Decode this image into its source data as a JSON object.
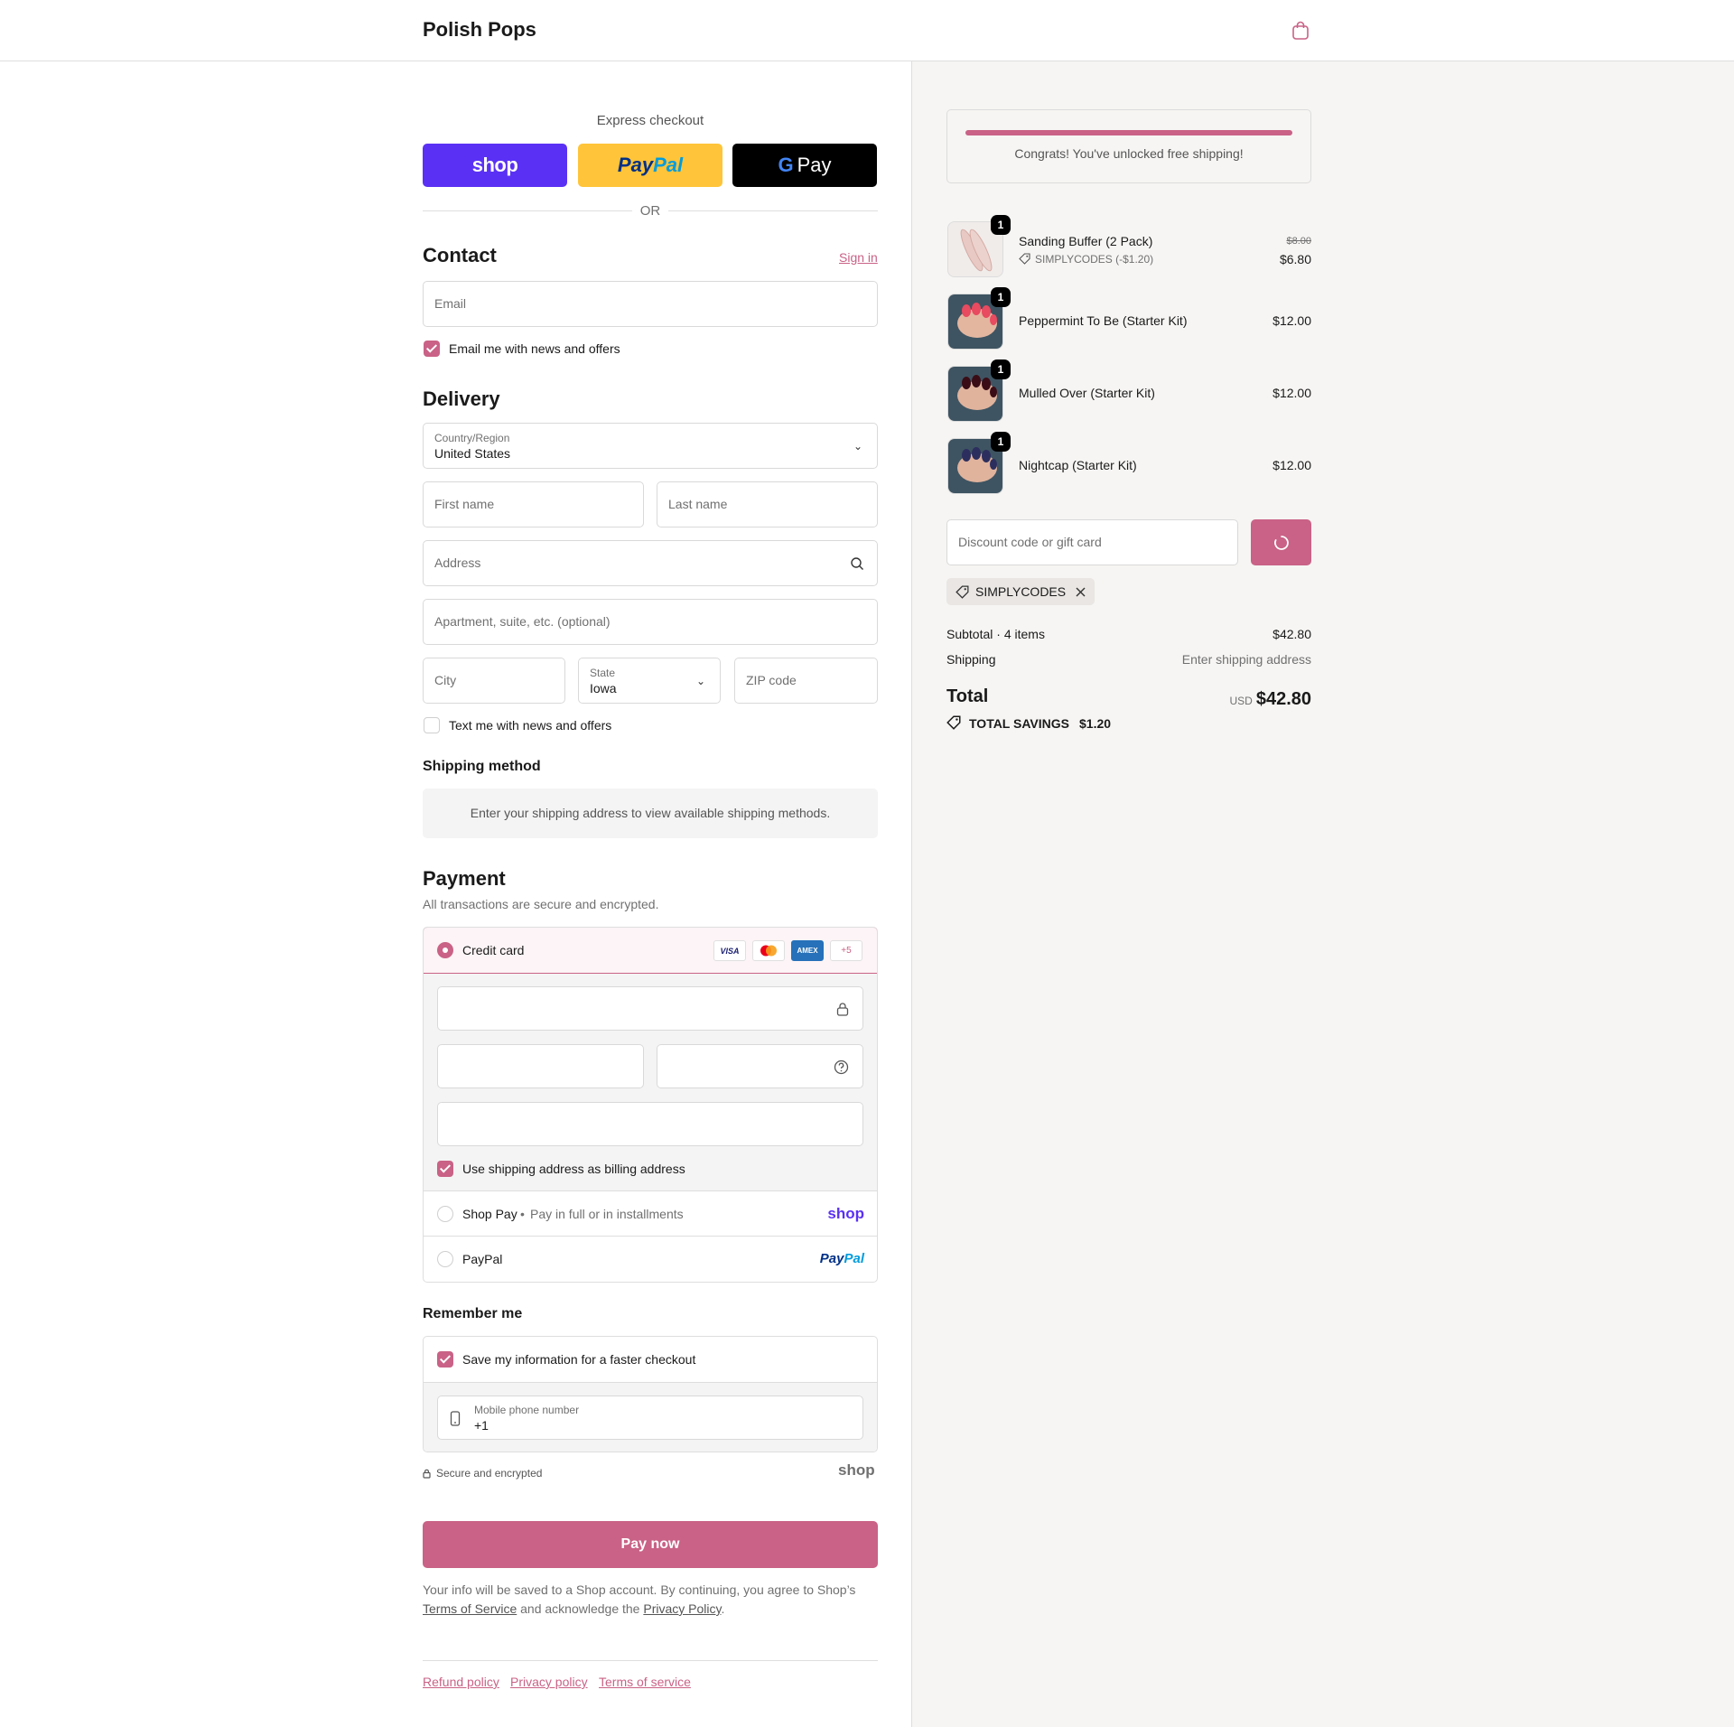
{
  "header": {
    "brand": "Polish Pops",
    "cart_icon": "shopping-bag-icon"
  },
  "express": {
    "title": "Express checkout",
    "shop_label": "shop",
    "paypal_label_1": "Pay",
    "paypal_label_2": "Pal",
    "gpay_g": "G",
    "gpay_label": "Pay",
    "or_text": "OR"
  },
  "contact": {
    "title": "Contact",
    "sign_in": "Sign in",
    "email_placeholder": "Email",
    "news_label": "Email me with news and offers",
    "news_checked": true
  },
  "delivery": {
    "title": "Delivery",
    "country_label": "Country/Region",
    "country_value": "United States",
    "first_name_placeholder": "First name",
    "last_name_placeholder": "Last name",
    "address_placeholder": "Address",
    "apartment_placeholder": "Apartment, suite, etc. (optional)",
    "city_placeholder": "City",
    "state_label": "State",
    "state_value": "Iowa",
    "zip_placeholder": "ZIP code",
    "text_label": "Text me with news and offers",
    "text_checked": false
  },
  "shipping_method": {
    "title": "Shipping method",
    "message": "Enter your shipping address to view available shipping methods."
  },
  "payment": {
    "title": "Payment",
    "subtitle": "All transactions are secure and encrypted.",
    "credit_card_label": "Credit card",
    "card_logos": [
      "VISA",
      "mastercard",
      "AMEX",
      "+5"
    ],
    "billing_label": "Use shipping address as billing address",
    "billing_checked": true,
    "shop_pay_label": "Shop Pay",
    "shop_pay_bullet": "•",
    "shop_pay_sub": "Pay in full or in installments",
    "shop_pay_logo": "shop",
    "paypal_label": "PayPal",
    "paypal_logo_1": "Pay",
    "paypal_logo_2": "Pal"
  },
  "remember": {
    "title": "Remember me",
    "save_label": "Save my information for a faster checkout",
    "save_checked": true,
    "phone_label": "Mobile phone number",
    "phone_value": "+1",
    "secure_label": "Secure and encrypted",
    "shop_logo": "shop"
  },
  "pay_now": "Pay now",
  "legal": {
    "line_1": "Your info will be saved to a Shop account. By continuing, you agree to Shop’s",
    "terms": "Terms of Service",
    "and_text": " and acknowledge the ",
    "privacy": "Privacy Policy",
    "period": "."
  },
  "footer_links": [
    "Refund policy",
    "Privacy policy",
    "Terms of service"
  ],
  "summary": {
    "free_shipping_message": "Congrats! You've unlocked free shipping!",
    "free_shipping_progress": 1.0,
    "items": [
      {
        "name": "Sanding Buffer (2 Pack)",
        "qty": "1",
        "discount": "SIMPLYCODES (-$1.20)",
        "original_price": "$8.00",
        "price": "$6.80"
      },
      {
        "name": "Peppermint To Be (Starter Kit)",
        "qty": "1",
        "price": "$12.00"
      },
      {
        "name": "Mulled Over (Starter Kit)",
        "qty": "1",
        "price": "$12.00"
      },
      {
        "name": "Nightcap (Starter Kit)",
        "qty": "1",
        "price": "$12.00"
      }
    ],
    "discount_placeholder": "Discount code or gift card",
    "applied_code": "SIMPLYCODES",
    "subtotal_label": "Subtotal · 4 items",
    "subtotal_value": "$42.80",
    "shipping_label": "Shipping",
    "shipping_value": "Enter shipping address",
    "total_label": "Total",
    "currency": "USD",
    "total_value": "$42.80",
    "savings_label": "TOTAL SAVINGS",
    "savings_value": "$1.20"
  },
  "colors": {
    "accent": "#c96286",
    "shop_purple": "#5a31f4",
    "paypal_yellow": "#ffc439"
  }
}
